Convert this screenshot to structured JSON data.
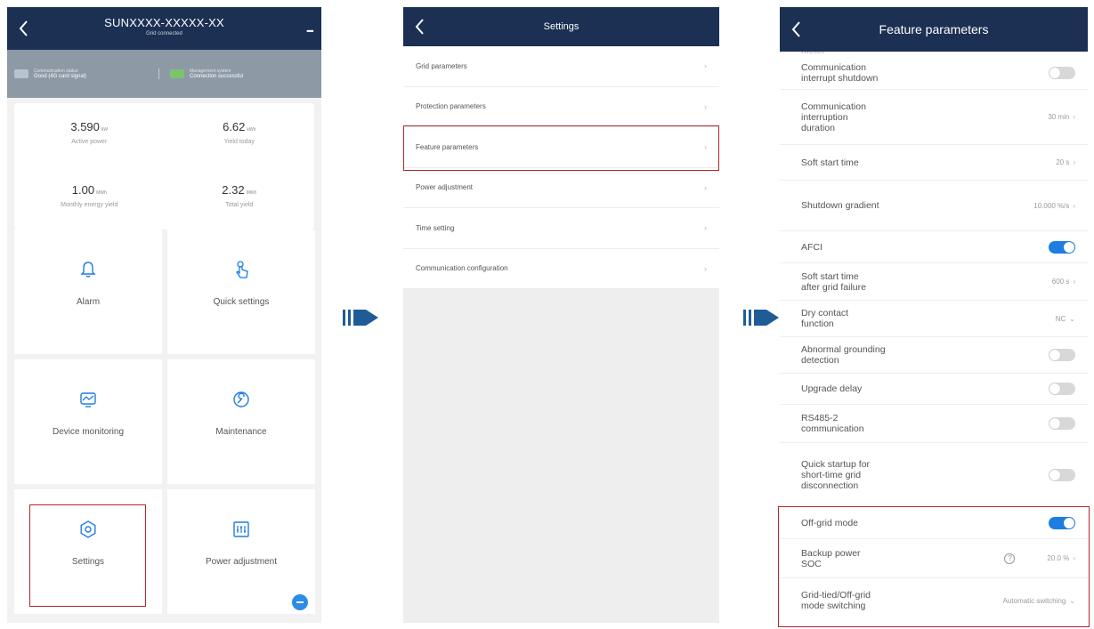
{
  "colors": {
    "nav": "#1b3053",
    "accent": "#1e7de0",
    "highlight": "#b0262c",
    "arrow": "#1f5c96"
  },
  "screen1": {
    "title": "SUNXXXX-XXXXX-XX",
    "subtitle": "Grid connected",
    "status": [
      {
        "label": "Communication status",
        "value": "Good (4G card signal)"
      },
      {
        "label": "Management system",
        "value": "Connection successful"
      }
    ],
    "kpis": [
      {
        "value": "3.590",
        "unit": "kW",
        "label": "Active power"
      },
      {
        "value": "6.62",
        "unit": "kWh",
        "label": "Yield today"
      },
      {
        "value": "1.00",
        "unit": "MWh",
        "label": "Monthly energy yield"
      },
      {
        "value": "2.32",
        "unit": "MWh",
        "label": "Total yield"
      }
    ],
    "tiles": [
      {
        "label": "Alarm",
        "icon": "bell-icon"
      },
      {
        "label": "Quick settings",
        "icon": "hand-tap-icon"
      },
      {
        "label": "Device monitoring",
        "icon": "monitor-icon"
      },
      {
        "label": "Maintenance",
        "icon": "wrench-icon"
      },
      {
        "label": "Settings",
        "icon": "gear-icon"
      },
      {
        "label": "Power adjustment",
        "icon": "power-adjust-icon"
      }
    ]
  },
  "screen2": {
    "title": "Settings",
    "items": [
      "Grid parameters",
      "Protection parameters",
      "Feature parameters",
      "Power adjustment",
      "Time setting",
      "Communication configuration"
    ]
  },
  "screen3": {
    "title": "Feature parameters",
    "partial_top": "meter",
    "rows": [
      {
        "label": "Communication\ninterrupt shutdown",
        "toggle": "off"
      },
      {
        "label": "Communication\ninterruption\nduration",
        "value": "30 min"
      },
      {
        "label": "Soft start time",
        "value": "20 s"
      },
      {
        "label": "Shutdown gradient",
        "value": "10.000 %/s"
      },
      {
        "label": "AFCI",
        "toggle": "on"
      },
      {
        "label": "Soft start time\nafter grid failure",
        "value": "600 s"
      },
      {
        "label": "Dry contact\nfunction",
        "value": "NC"
      },
      {
        "label": "Abnormal grounding\ndetection",
        "toggle": "off"
      },
      {
        "label": "Upgrade delay",
        "toggle": "off"
      },
      {
        "label": "RS485-2\ncommunication",
        "toggle": "off"
      },
      {
        "label": "Quick startup for\nshort-time grid\ndisconnection",
        "toggle": "off"
      },
      {
        "label": "Off-grid mode",
        "toggle": "on"
      },
      {
        "label": "Backup power\nSOC",
        "value": "20.0 %"
      },
      {
        "label": "Grid-tied/Off-grid\nmode switching",
        "value": "Automatic switching"
      }
    ]
  }
}
